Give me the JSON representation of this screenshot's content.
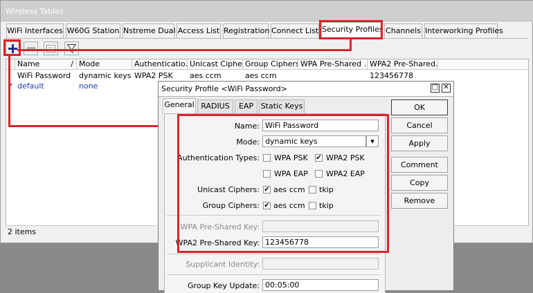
{
  "window": {
    "title": "Wireless Tables"
  },
  "tabs": [
    "WiFi Interfaces",
    "W60G Station",
    "Nstreme Dual",
    "Access List",
    "Registration",
    "Connect List",
    "Security Profiles",
    "Channels",
    "Interworking Profiles"
  ],
  "toolbar": {
    "add": "add-icon",
    "remove": "remove-icon",
    "comment": "comment-icon",
    "filter": "filter-icon"
  },
  "table": {
    "columns": [
      "Name",
      "Mode",
      "Authenticatio...",
      "Unicast Ciphers",
      "Group Ciphers",
      "WPA Pre-Shared ...",
      "WPA2 Pre-Shared..."
    ],
    "sort_marker": "/",
    "rows": [
      [
        "WiFi Password",
        "dynamic keys",
        "WPA2 PSK",
        "aes ccm",
        "aes ccm",
        "",
        "123456778"
      ],
      [
        "default",
        "none",
        "",
        "",
        "",
        "",
        ""
      ]
    ],
    "default_marker": "*",
    "status": "2 items"
  },
  "dialog": {
    "title": "Security Profile <WiFi Password>",
    "tabs": [
      "General",
      "RADIUS",
      "EAP",
      "Static Keys"
    ],
    "fields": {
      "name_label": "Name:",
      "name_value": "WiFi Password",
      "mode_label": "Mode:",
      "mode_value": "dynamic keys",
      "auth_label": "Authentication Types:",
      "auth_options": [
        {
          "label": "WPA PSK",
          "checked": false
        },
        {
          "label": "WPA2 PSK",
          "checked": true
        },
        {
          "label": "WPA EAP",
          "checked": false
        },
        {
          "label": "WPA2 EAP",
          "checked": false
        }
      ],
      "unicast_label": "Unicast Ciphers:",
      "unicast_options": [
        {
          "label": "aes ccm",
          "checked": true
        },
        {
          "label": "tkip",
          "checked": false
        }
      ],
      "group_label": "Group Ciphers:",
      "group_options": [
        {
          "label": "aes ccm",
          "checked": true
        },
        {
          "label": "tkip",
          "checked": false
        }
      ],
      "wpa_key_label": "WPA Pre-Shared Key:",
      "wpa_key_value": "",
      "wpa2_key_label": "WPA2 Pre-Shared Key:",
      "wpa2_key_value": "123456778",
      "supplicant_label": "Supplicant Identity:",
      "supplicant_value": "",
      "group_key_update_label": "Group Key Update:",
      "group_key_update_value": "00:05:00"
    },
    "buttons": [
      "OK",
      "Cancel",
      "Apply",
      "Comment",
      "Copy",
      "Remove"
    ],
    "check_glyph": "✔",
    "dropdown_glyph": "▾",
    "window_buttons": {
      "restore": "□",
      "close": "✕"
    }
  },
  "colors": {
    "highlight": "#d9242a",
    "add_icon": "#1a2f8c",
    "default_row_text": "#1c3fa8"
  }
}
